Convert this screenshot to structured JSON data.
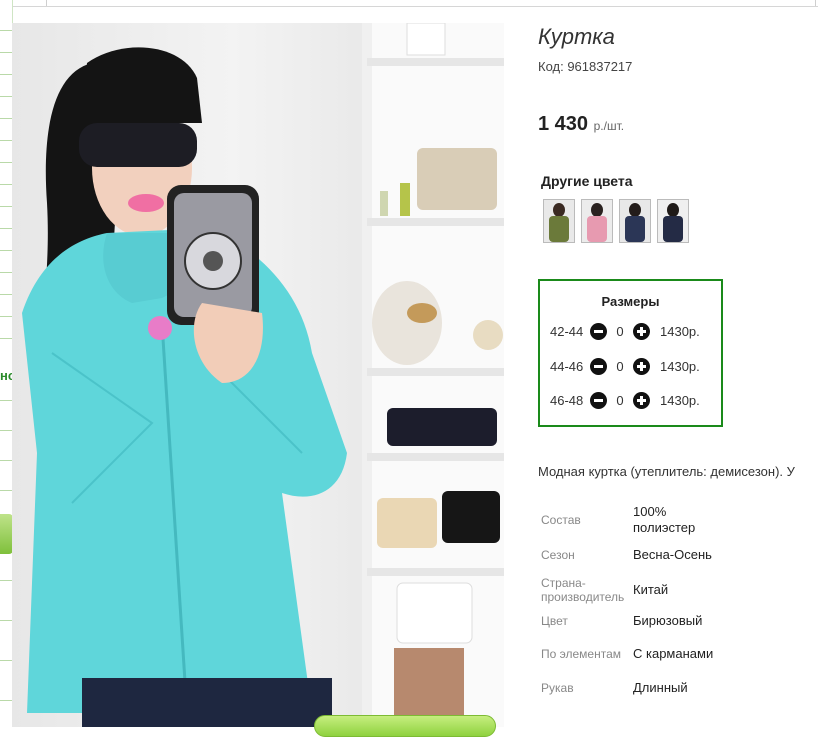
{
  "sidebar": {
    "fragment_text": "но"
  },
  "product": {
    "title": "Куртка",
    "code": "Код: 961837217",
    "price": "1 430",
    "price_unit": "р./шт."
  },
  "colors": {
    "heading": "Другие цвета",
    "swatches": [
      {
        "name": "olive",
        "color": "#6b7a3a"
      },
      {
        "name": "pink",
        "color": "#e79ab0"
      },
      {
        "name": "navy",
        "color": "#2b3656"
      },
      {
        "name": "dark-navy",
        "color": "#242b45"
      }
    ]
  },
  "sizes": {
    "heading": "Размеры",
    "rows": [
      {
        "label": "42-44",
        "qty": "0",
        "price": "1430р."
      },
      {
        "label": "44-46",
        "qty": "0",
        "price": "1430р."
      },
      {
        "label": "46-48",
        "qty": "0",
        "price": "1430р."
      }
    ]
  },
  "description": "Модная куртка (утеплитель: демисезон). У",
  "specs": [
    {
      "key": "Состав",
      "value": "100% полиэстер"
    },
    {
      "key": "Сезон",
      "value": "Весна-Осень"
    },
    {
      "key": "Страна-производитель",
      "value": "Китай"
    },
    {
      "key": "Цвет",
      "value": "Бирюзовый"
    },
    {
      "key": "По элементам",
      "value": "С карманами"
    },
    {
      "key": "Рукав",
      "value": "Длинный"
    }
  ],
  "theme": {
    "accent": "#1a8a1a",
    "jacket": "#5fd6da"
  }
}
